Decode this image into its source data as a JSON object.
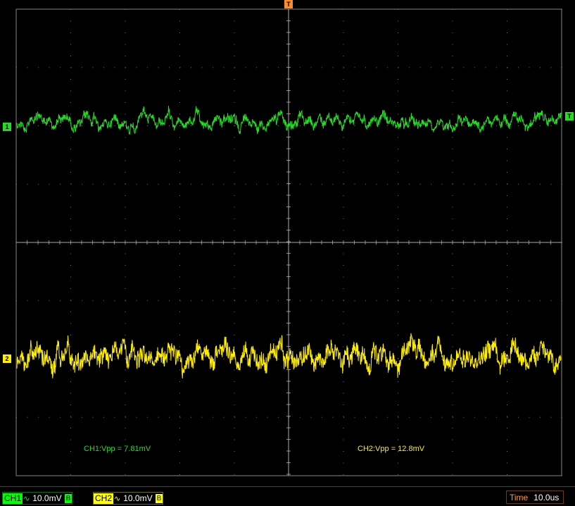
{
  "markers": {
    "trigger": "T",
    "ch1_ground": "1",
    "ch2_ground": "2",
    "trigger_level": "T"
  },
  "measurements": {
    "ch1": "CH1:Vpp = 7.81mV",
    "ch2": "CH2:Vpp = 12.8mV"
  },
  "status": {
    "ch1": {
      "label": "CH1",
      "coupling": "∿",
      "scale": "10.0mV",
      "bw": "B",
      "color": "#00ff00"
    },
    "ch2": {
      "label": "CH2",
      "coupling": "∿",
      "scale": "10.0mV",
      "bw": "B",
      "color": "#ffff00"
    },
    "time": {
      "label": "Time",
      "value": "10.0us",
      "color": "#ff9a35"
    }
  },
  "colors": {
    "ch1": "#22dd22",
    "ch2": "#ffee00",
    "grid": "#888888",
    "trigger": "#ff8c2a"
  }
}
